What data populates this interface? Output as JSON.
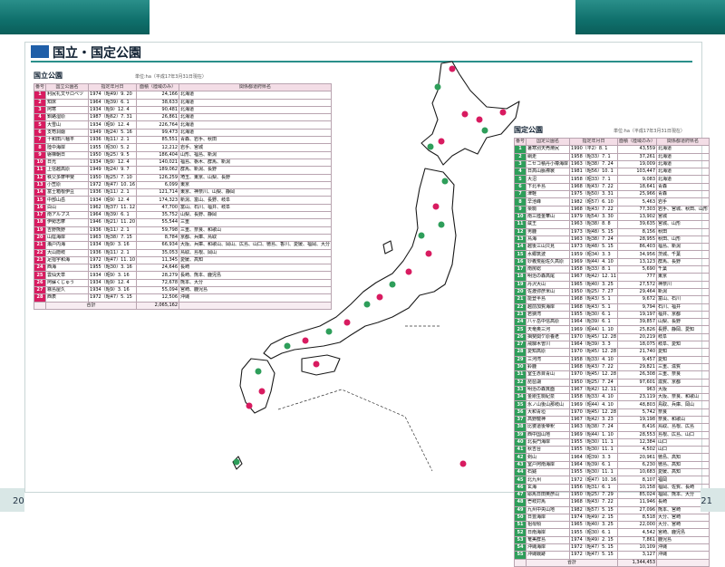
{
  "header": {
    "title": "国立・国定公園"
  },
  "pages": {
    "left": "20",
    "right": "21"
  },
  "national": {
    "label": "国立公園",
    "note": "単位:ha（平成17年3月31日現在）",
    "headers": [
      "番号",
      "国立公園名",
      "指定年月日",
      "面積（陸域のみ）",
      "関係都道府県名"
    ],
    "accent": "#d81b60",
    "rows": [
      [
        "1",
        "利尻礼文サロベツ",
        "1974（昭49）9. 20",
        "24,166",
        "北海道"
      ],
      [
        "2",
        "知床",
        "1964（昭39）6. 1",
        "38,633",
        "北海道"
      ],
      [
        "3",
        "阿寒",
        "1934（昭9）12. 4",
        "90,481",
        "北海道"
      ],
      [
        "4",
        "釧路湿原",
        "1987（昭62）7. 31",
        "26,861",
        "北海道"
      ],
      [
        "5",
        "大雪山",
        "1934（昭9）12. 4",
        "226,764",
        "北海道"
      ],
      [
        "6",
        "支笏洞爺",
        "1949（昭24）5. 16",
        "99,473",
        "北海道"
      ],
      [
        "7",
        "十和田八幡平",
        "1936（昭11）2. 1",
        "85,551",
        "青森、岩手、秋田"
      ],
      [
        "8",
        "陸中海岸",
        "1955（昭30）5. 2",
        "12,212",
        "岩手、宮城"
      ],
      [
        "9",
        "磐梯朝日",
        "1950（昭25）9. 5",
        "186,404",
        "山形、福島、新潟"
      ],
      [
        "10",
        "日光",
        "1934（昭9）12. 4",
        "140,021",
        "福島、栃木、群馬、新潟"
      ],
      [
        "11",
        "上信越高原",
        "1949（昭24）9. 7",
        "189,062",
        "群馬、新潟、長野"
      ],
      [
        "12",
        "秩父多摩甲斐",
        "1950（昭25）7. 10",
        "126,259",
        "埼玉、東京、山梨、長野"
      ],
      [
        "13",
        "小笠原",
        "1972（昭47）10. 16",
        "6,099",
        "東京"
      ],
      [
        "14",
        "富士箱根伊豆",
        "1936（昭11）2. 1",
        "121,714",
        "東京、神奈川、山梨、静岡"
      ],
      [
        "15",
        "中部山岳",
        "1934（昭9）12. 4",
        "174,323",
        "新潟、富山、長野、岐阜"
      ],
      [
        "16",
        "白山",
        "1962（昭37）11. 12",
        "47,700",
        "富山、石川、福井、岐阜"
      ],
      [
        "17",
        "南アルプス",
        "1964（昭39）6. 1",
        "35,752",
        "山梨、長野、静岡"
      ],
      [
        "18",
        "伊勢志摩",
        "1946（昭21）11. 20",
        "55,544",
        "三重"
      ],
      [
        "19",
        "吉野熊野",
        "1936（昭11）2. 1",
        "59,798",
        "三重、奈良、和歌山"
      ],
      [
        "20",
        "山陰海岸",
        "1963（昭38）7. 15",
        "8,784",
        "京都、兵庫、鳥取"
      ],
      [
        "21",
        "瀬戸内海",
        "1934（昭9）3. 16",
        "66,934",
        "大阪、兵庫、和歌山、岡山、広島、山口、徳島、香川、愛媛、福岡、大分"
      ],
      [
        "22",
        "大山隠岐",
        "1936（昭11）2. 1",
        "35,053",
        "鳥取、島根、岡山"
      ],
      [
        "23",
        "足摺宇和海",
        "1972（昭47）11. 10",
        "11,345",
        "愛媛、高知"
      ],
      [
        "24",
        "西海",
        "1955（昭30）3. 16",
        "24,646",
        "長崎"
      ],
      [
        "25",
        "雲仙天草",
        "1934（昭9）3. 16",
        "28,279",
        "長崎、熊本、鹿児島"
      ],
      [
        "26",
        "阿蘇くじゅう",
        "1934（昭9）12. 4",
        "72,678",
        "熊本、大分"
      ],
      [
        "27",
        "霧島屋久",
        "1934（昭9）3. 16",
        "55,094",
        "宮崎、鹿児島"
      ],
      [
        "28",
        "西表",
        "1972（昭47）5. 15",
        "12,506",
        "沖縄"
      ]
    ],
    "total": {
      "label": "合計",
      "value": "2,065,162"
    }
  },
  "quasi": {
    "label": "国定公園",
    "note": "単位:ha（平成17年3月31日現在）",
    "headers": [
      "番号",
      "国定公園名",
      "指定年月日",
      "面積（陸域のみ）",
      "関係都道府県名"
    ],
    "accent": "#2e9e5a",
    "rows": [
      [
        "1",
        "暑寒別天売焼尻",
        "1990（平2）8. 1",
        "43,559",
        "北海道"
      ],
      [
        "2",
        "網走",
        "1958（昭33）7. 1",
        "37,261",
        "北海道"
      ],
      [
        "3",
        "ニセコ積丹小樽海岸",
        "1963（昭38）7. 24",
        "19,009",
        "北海道"
      ],
      [
        "4",
        "日高山脈襟裳",
        "1981（昭56）10. 1",
        "103,447",
        "北海道"
      ],
      [
        "5",
        "大沼",
        "1958（昭33）7. 1",
        "9,083",
        "北海道"
      ],
      [
        "6",
        "下北半島",
        "1968（昭43）7. 22",
        "18,641",
        "青森"
      ],
      [
        "7",
        "津軽",
        "1975（昭50）3. 31",
        "25,966",
        "青森"
      ],
      [
        "8",
        "早池峰",
        "1982（昭57）6. 10",
        "5,463",
        "岩手"
      ],
      [
        "9",
        "栗駒",
        "1968（昭43）7. 22",
        "77,303",
        "岩手、宮城、秋田、山形"
      ],
      [
        "10",
        "南三陸金華山",
        "1979（昭54）3. 30",
        "13,902",
        "宮城"
      ],
      [
        "11",
        "蔵王",
        "1963（昭38）8. 8",
        "39,635",
        "宮城、山形"
      ],
      [
        "12",
        "男鹿",
        "1973（昭48）5. 15",
        "8,156",
        "秋田"
      ],
      [
        "13",
        "鳥海",
        "1963（昭38）7. 24",
        "28,955",
        "秋田、山形"
      ],
      [
        "14",
        "越後三山只見",
        "1973（昭48）5. 15",
        "86,403",
        "福島、新潟"
      ],
      [
        "15",
        "水郷筑波",
        "1959（昭34）3. 3",
        "34,956",
        "茨城、千葉"
      ],
      [
        "16",
        "妙義荒船佐久高原",
        "1969（昭44）4. 10",
        "13,123",
        "群馬、長野"
      ],
      [
        "17",
        "南房総",
        "1958（昭33）8. 1",
        "5,690",
        "千葉"
      ],
      [
        "18",
        "明治の森高尾",
        "1967（昭42）12. 11",
        "777",
        "東京"
      ],
      [
        "19",
        "丹沢大山",
        "1965（昭40）3. 25",
        "27,572",
        "神奈川"
      ],
      [
        "20",
        "佐渡弥彦米山",
        "1950（昭25）7. 27",
        "29,464",
        "新潟"
      ],
      [
        "21",
        "能登半島",
        "1968（昭43）5. 1",
        "9,672",
        "富山、石川"
      ],
      [
        "22",
        "越前加賀海岸",
        "1968（昭43）5. 1",
        "9,794",
        "石川、福井"
      ],
      [
        "23",
        "若狭湾",
        "1955（昭30）6. 1",
        "19,197",
        "福井、京都"
      ],
      [
        "24",
        "八ヶ岳中信高原",
        "1964（昭39）6. 1",
        "39,857",
        "山梨、長野"
      ],
      [
        "25",
        "天竜奥三河",
        "1969（昭44）1. 10",
        "25,826",
        "長野、静岡、愛知"
      ],
      [
        "26",
        "揖斐関ケ原養老",
        "1970（昭45）12. 28",
        "20,219",
        "岐阜"
      ],
      [
        "27",
        "飛騨木曽川",
        "1964（昭39）3. 3",
        "18,075",
        "岐阜、愛知"
      ],
      [
        "28",
        "愛知高原",
        "1970（昭45）12. 28",
        "21,740",
        "愛知"
      ],
      [
        "29",
        "三河湾",
        "1958（昭33）4. 10",
        "9,457",
        "愛知"
      ],
      [
        "30",
        "鈴鹿",
        "1968（昭43）7. 22",
        "29,821",
        "三重、滋賀"
      ],
      [
        "31",
        "室生赤目青山",
        "1970（昭45）12. 28",
        "26,308",
        "三重、奈良"
      ],
      [
        "32",
        "琵琶湖",
        "1950（昭25）7. 24",
        "97,601",
        "滋賀、京都"
      ],
      [
        "33",
        "明治の森箕面",
        "1967（昭42）12. 11",
        "963",
        "大阪"
      ],
      [
        "34",
        "金剛生駒紀泉",
        "1958（昭33）4. 10",
        "23,119",
        "大阪、奈良、和歌山"
      ],
      [
        "35",
        "氷ノ山後山那岐山",
        "1969（昭44）4. 10",
        "48,803",
        "鳥取、兵庫、岡山"
      ],
      [
        "36",
        "大和青垣",
        "1970（昭45）12. 28",
        "5,742",
        "奈良"
      ],
      [
        "37",
        "高野龍神",
        "1967（昭42）3. 23",
        "19,198",
        "奈良、和歌山"
      ],
      [
        "38",
        "比婆道後帝釈",
        "1963（昭38）7. 24",
        "8,416",
        "鳥取、島根、広島"
      ],
      [
        "39",
        "西中国山地",
        "1969（昭44）1. 10",
        "28,553",
        "島根、広島、山口"
      ],
      [
        "40",
        "北長門海岸",
        "1955（昭30）11. 1",
        "12,384",
        "山口"
      ],
      [
        "41",
        "秋吉台",
        "1955（昭30）11. 1",
        "4,502",
        "山口"
      ],
      [
        "42",
        "剣山",
        "1964（昭39）3. 3",
        "20,961",
        "徳島、高知"
      ],
      [
        "43",
        "室戸阿南海岸",
        "1964（昭39）6. 1",
        "6,230",
        "徳島、高知"
      ],
      [
        "44",
        "石鎚",
        "1955（昭30）11. 1",
        "10,683",
        "愛媛、高知"
      ],
      [
        "45",
        "北九州",
        "1972（昭47）10. 16",
        "8,107",
        "福岡"
      ],
      [
        "46",
        "玄海",
        "1956（昭31）6. 1",
        "10,158",
        "福岡、佐賀、長崎"
      ],
      [
        "47",
        "耶馬日田英彦山",
        "1950（昭25）7. 29",
        "85,024",
        "福岡、熊本、大分"
      ],
      [
        "48",
        "壱岐対馬",
        "1968（昭43）7. 22",
        "11,946",
        "長崎"
      ],
      [
        "49",
        "九州中央山地",
        "1982（昭57）5. 15",
        "27,096",
        "熊本、宮崎"
      ],
      [
        "50",
        "日豊海岸",
        "1974（昭49）2. 15",
        "8,518",
        "大分、宮崎"
      ],
      [
        "51",
        "祖母傾",
        "1965（昭40）3. 25",
        "22,000",
        "大分、宮崎"
      ],
      [
        "52",
        "日南海岸",
        "1955（昭30）6. 1",
        "4,542",
        "宮崎、鹿児島"
      ],
      [
        "53",
        "奄美群島",
        "1974（昭49）2. 15",
        "7,861",
        "鹿児島"
      ],
      [
        "54",
        "沖縄海岸",
        "1972（昭47）5. 15",
        "10,109",
        "沖縄"
      ],
      [
        "55",
        "沖縄戦跡",
        "1972（昭47）5. 15",
        "3,127",
        "沖縄"
      ]
    ],
    "total": {
      "label": "合計",
      "value": "1,344,453"
    }
  }
}
